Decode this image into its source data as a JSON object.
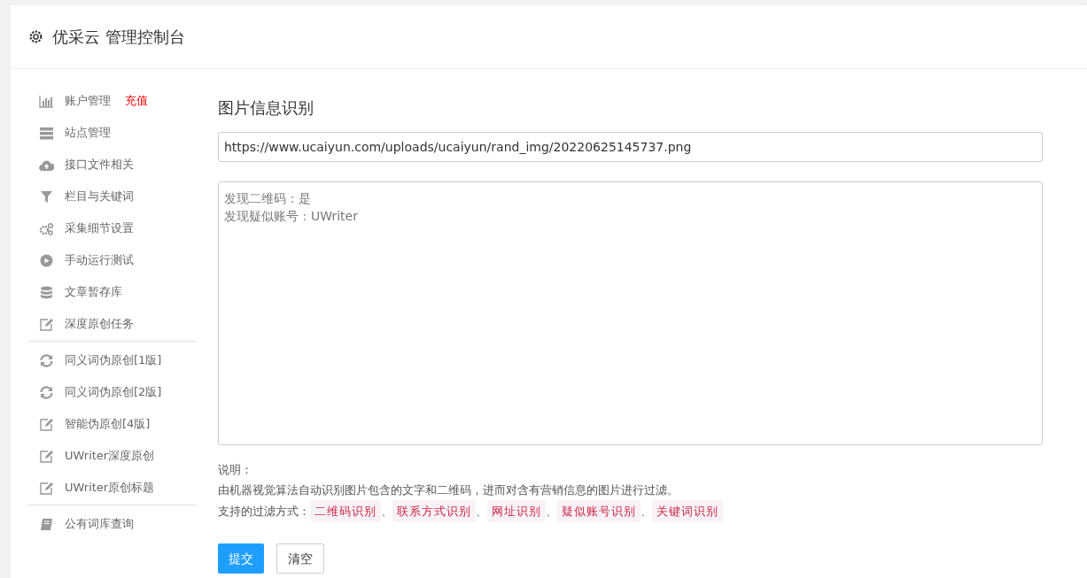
{
  "header": {
    "title": "优采云 管理控制台"
  },
  "sidebar": {
    "groups": [
      {
        "items": [
          {
            "label": "账户管理",
            "kind": "chart",
            "badge": "充值"
          },
          {
            "label": "站点管理",
            "kind": "server"
          },
          {
            "label": "接口文件相关",
            "kind": "cloud"
          },
          {
            "label": "栏目与关键词",
            "kind": "filter"
          },
          {
            "label": "采集细节设置",
            "kind": "gears"
          },
          {
            "label": "手动运行测试",
            "kind": "play"
          },
          {
            "label": "文章暂存库",
            "kind": "database"
          },
          {
            "label": "深度原创任务",
            "kind": "edit"
          }
        ]
      },
      {
        "items": [
          {
            "label": "同义词伪原创[1版]",
            "kind": "refresh"
          },
          {
            "label": "同义词伪原创[2版]",
            "kind": "refresh"
          },
          {
            "label": "智能伪原创[4版]",
            "kind": "edit"
          },
          {
            "label": "UWriter深度原创",
            "kind": "edit"
          },
          {
            "label": "UWriter原创标题",
            "kind": "edit"
          }
        ]
      },
      {
        "items": [
          {
            "label": "公有词库查询",
            "kind": "book"
          }
        ]
      }
    ]
  },
  "main": {
    "title": "图片信息识别",
    "url_field": {
      "value": "https://www.ucaiyun.com/uploads/ucaiyun/rand_img/20220625145737.png"
    },
    "result": {
      "lines": [
        "发现二维码：是",
        "发现疑似账号：UWriter"
      ]
    },
    "note_label": "说明：",
    "note": "由机器视觉算法自动识别图片包含的文字和二维码，进而对含有营销信息的图片进行过滤。",
    "filters_label": "支持的过滤方式：",
    "filters": [
      "二维码识别",
      "联系方式识别",
      "网址识别",
      "疑似账号识别",
      "关键词识别"
    ],
    "separator": "、",
    "buttons": [
      {
        "label": "提交",
        "kind": "primary"
      },
      {
        "label": "清空",
        "kind": "secondary"
      }
    ]
  }
}
